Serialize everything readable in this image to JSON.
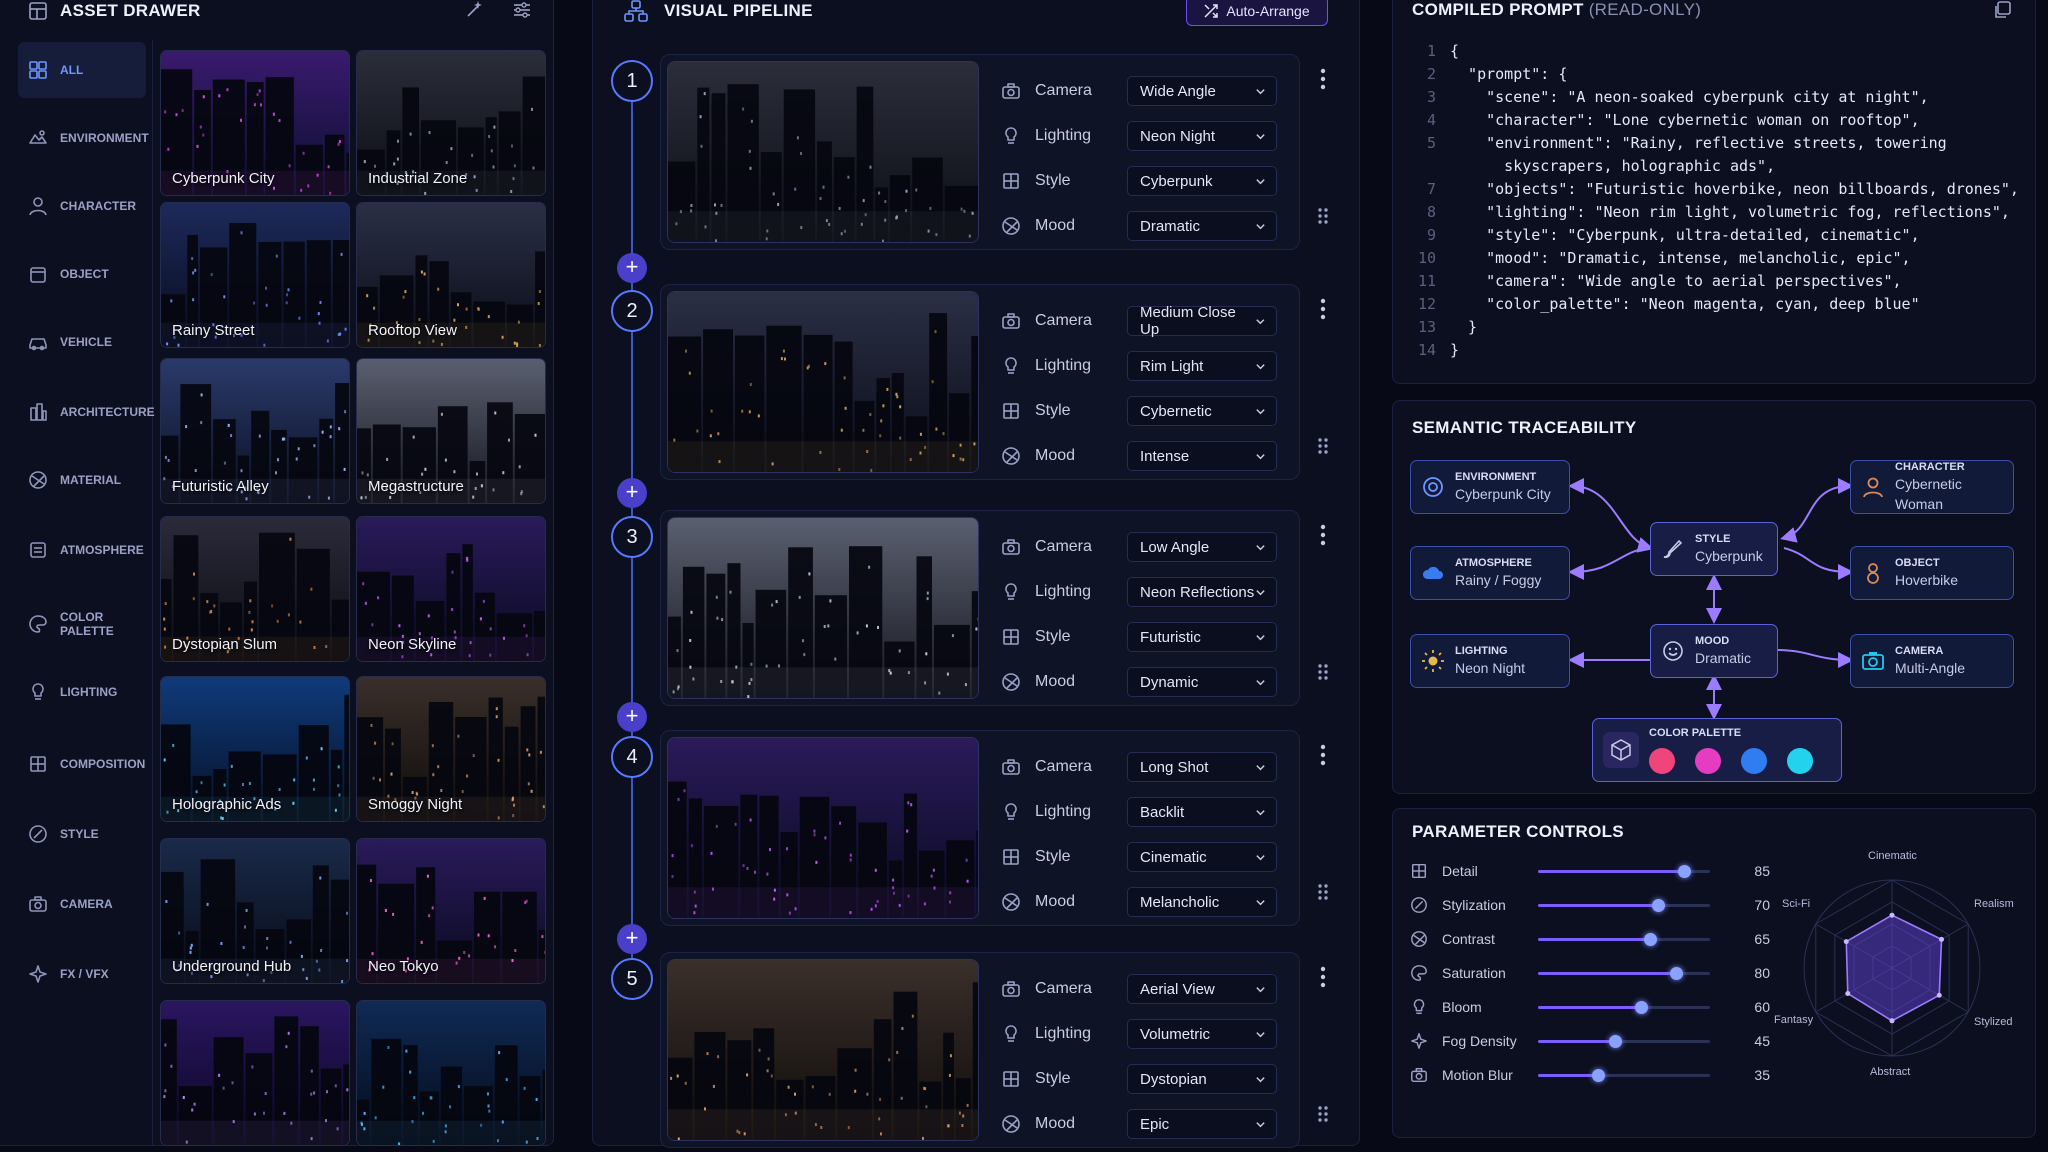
{
  "drawer": {
    "title": "ASSET DRAWER",
    "categories": [
      {
        "label": "ALL",
        "icon": "grid-icon",
        "active": true
      },
      {
        "label": "ENVIRONMENT",
        "icon": "environment-icon"
      },
      {
        "label": "CHARACTER",
        "icon": "person-icon"
      },
      {
        "label": "OBJECT",
        "icon": "box-icon"
      },
      {
        "label": "VEHICLE",
        "icon": "car-icon"
      },
      {
        "label": "ARCHITECTURE",
        "icon": "building-icon"
      },
      {
        "label": "MATERIAL",
        "icon": "material-icon"
      },
      {
        "label": "ATMOSPHERE",
        "icon": "atmosphere-icon"
      },
      {
        "label": "COLOR\nPALETTE",
        "icon": "palette-icon"
      },
      {
        "label": "LIGHTING",
        "icon": "lightbulb-icon"
      },
      {
        "label": "COMPOSITION",
        "icon": "composition-icon"
      },
      {
        "label": "STYLE",
        "icon": "brush-icon"
      },
      {
        "label": "CAMERA",
        "icon": "camera-icon"
      },
      {
        "label": "FX / VFX",
        "icon": "sparkle-icon"
      }
    ],
    "assets": [
      "Cyberpunk City",
      "Industrial Zone",
      "Rainy Street",
      "Rooftop View",
      "Futuristic Alley",
      "Megastructure",
      "Dystopian Slum",
      "Neon Skyline",
      "Holographic Ads",
      "Smoggy Night",
      "Underground Hub",
      "Neo Tokyo",
      "",
      ""
    ]
  },
  "pipeline": {
    "title": "VISUAL PIPELINE",
    "auto_arrange": "Auto-Arrange",
    "param_labels": [
      "Camera",
      "Lighting",
      "Style",
      "Mood"
    ],
    "steps": [
      {
        "num": "1",
        "values": [
          "Wide Angle",
          "Neon Night",
          "Cyberpunk",
          "Dramatic"
        ]
      },
      {
        "num": "2",
        "values": [
          "Medium Close Up",
          "Rim Light",
          "Cybernetic",
          "Intense"
        ]
      },
      {
        "num": "3",
        "values": [
          "Low Angle",
          "Neon Reflections",
          "Futuristic",
          "Dynamic"
        ]
      },
      {
        "num": "4",
        "values": [
          "Long Shot",
          "Backlit",
          "Cinematic",
          "Melancholic"
        ]
      },
      {
        "num": "5",
        "values": [
          "Aerial View",
          "Volumetric",
          "Dystopian",
          "Epic"
        ]
      }
    ]
  },
  "prompt": {
    "title": "COMPILED PROMPT",
    "subtitle": "(READ-ONLY)",
    "lines": [
      {
        "n": "1",
        "t": "{"
      },
      {
        "n": "2",
        "t": "  \"prompt\": {"
      },
      {
        "n": "3",
        "t": "    \"scene\": \"A neon-soaked cyberpunk city at night\","
      },
      {
        "n": "4",
        "t": "    \"character\": \"Lone cybernetic woman on rooftop\","
      },
      {
        "n": "5",
        "t": "    \"environment\": \"Rainy, reflective streets, towering"
      },
      {
        "n": "",
        "t": "      skyscrapers, holographic ads\","
      },
      {
        "n": "7",
        "t": "    \"objects\": \"Futuristic hoverbike, neon billboards, drones\","
      },
      {
        "n": "8",
        "t": "    \"lighting\": \"Neon rim light, volumetric fog, reflections\","
      },
      {
        "n": "9",
        "t": "    \"style\": \"Cyberpunk, ultra-detailed, cinematic\","
      },
      {
        "n": "10",
        "t": "    \"mood\": \"Dramatic, intense, melancholic, epic\","
      },
      {
        "n": "11",
        "t": "    \"camera\": \"Wide angle to aerial perspectives\","
      },
      {
        "n": "12",
        "t": "    \"color_palette\": \"Neon magenta, cyan, deep blue\""
      },
      {
        "n": "13",
        "t": "  }"
      },
      {
        "n": "14",
        "t": "}"
      }
    ]
  },
  "trace": {
    "title": "SEMANTIC TRACEABILITY",
    "nodes": {
      "environment": {
        "t": "ENVIRONMENT",
        "v": "Cyberpunk City"
      },
      "atmosphere": {
        "t": "ATMOSPHERE",
        "v": "Rainy / Foggy"
      },
      "lighting": {
        "t": "LIGHTING",
        "v": "Neon Night"
      },
      "style": {
        "t": "STYLE",
        "v": "Cyberpunk"
      },
      "mood": {
        "t": "MOOD",
        "v": "Dramatic"
      },
      "character": {
        "t": "CHARACTER",
        "v": "Cybernetic Woman"
      },
      "object": {
        "t": "OBJECT",
        "v": "Hoverbike"
      },
      "camera": {
        "t": "CAMERA",
        "v": "Multi-Angle"
      },
      "palette": {
        "t": "COLOR PALETTE",
        "v": ""
      }
    },
    "palette_colors": [
      "#f0457a",
      "#e63cc2",
      "#2f7df0",
      "#23d3ee"
    ]
  },
  "params": {
    "title": "PARAMETER CONTROLS",
    "items": [
      {
        "label": "Detail",
        "value": 85
      },
      {
        "label": "Stylization",
        "value": 70
      },
      {
        "label": "Contrast",
        "value": 65
      },
      {
        "label": "Saturation",
        "value": 80
      },
      {
        "label": "Bloom",
        "value": 60
      },
      {
        "label": "Fog Density",
        "value": 45
      },
      {
        "label": "Motion Blur",
        "value": 35
      }
    ],
    "radar_axes": [
      "Cinematic",
      "Realism",
      "Stylized",
      "Abstract",
      "Fantasy",
      "Sci-Fi"
    ]
  },
  "colors": {
    "accent": "#7b5cff",
    "node_border": "#3c4ea8",
    "step_ring": "#5879ff"
  }
}
